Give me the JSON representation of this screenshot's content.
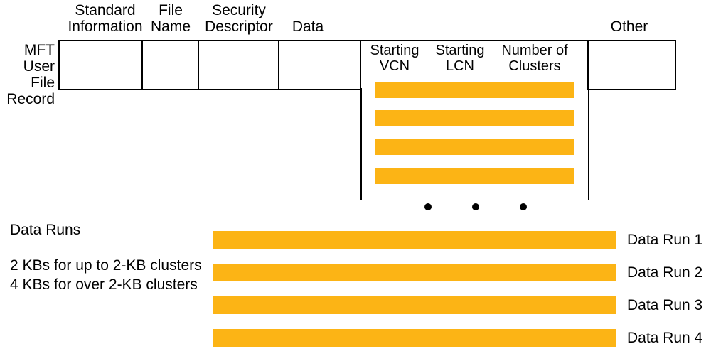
{
  "top_labels": {
    "standard_information_line1": "Standard",
    "standard_information_line2": "Information",
    "file_name_line1": "File",
    "file_name_line2": "Name",
    "security_descriptor_line1": "Security",
    "security_descriptor_line2": "Descriptor",
    "data": "Data",
    "other": "Other"
  },
  "left_label": {
    "line1": "MFT",
    "line2": "User",
    "line3": "File",
    "line4": "Record"
  },
  "mapping_headers": {
    "starting_vcn_line1": "Starting",
    "starting_vcn_line2": "VCN",
    "starting_lcn_line1": "Starting",
    "starting_lcn_line2": "LCN",
    "num_clusters_line1": "Number of",
    "num_clusters_line2": "Clusters"
  },
  "lower_left": {
    "title": "Data Runs",
    "note1": "2 KBs for up to 2-KB clusters",
    "note2": "4 KBs for over 2-KB clusters"
  },
  "run_labels": {
    "r1": "Data Run 1",
    "r2": "Data Run 2",
    "r3": "Data Run 3",
    "r4": "Data Run 4"
  },
  "colors": {
    "accent": "#fcb415"
  }
}
